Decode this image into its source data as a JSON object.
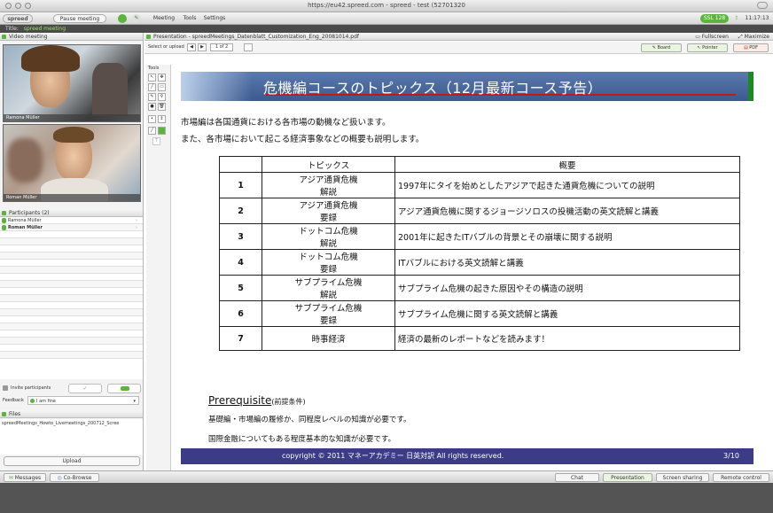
{
  "window": {
    "url": "https://eu42.spreed.com - spreed - test (52701320"
  },
  "appbar": {
    "logo": "spreed",
    "pause_label": "Pause meeting",
    "menu": [
      "Meeting",
      "Tools",
      "Settings"
    ],
    "status_badge": "SSL 128",
    "clock": "11:17:13"
  },
  "title_strip": {
    "label": "Title:",
    "value": "spreed meeting"
  },
  "left_panel": {
    "video_title": "Video meeting",
    "videos": [
      {
        "name": "Ramona Müller"
      },
      {
        "name": "Roman Müller"
      }
    ],
    "participants_title": "Participants (2)",
    "participants": [
      "Ramona Müller",
      "Roman Müller"
    ],
    "invite_label": "Invite participants",
    "feedback_label": "Feedback",
    "feedback_value": "I am fine",
    "files_title": "Files",
    "file_name": "spreedMeetings_Howto_Livemeetings_200712_Scree",
    "upload_label": "Upload"
  },
  "presentation": {
    "title": "Presentation - spreedMeetings_Datenblatt_Customization_Eng_20081014.pdf",
    "select_label": "Select or upload",
    "page": "1 of 2",
    "fullscreen_label": "Fullscreen",
    "maximize_label": "Maximize",
    "board_label": "Board",
    "pointer_label": "Pointer",
    "pdf_label": "PDF",
    "tools_label": "Tools"
  },
  "slide": {
    "title": "危機編コースのトピックス（12月最新コース予告）",
    "intro1": "市場編は各国通貨における各市場の動機など扱います。",
    "intro2": "また、各市場において起こる経済事象などの概要も説明します。",
    "table_headers": [
      "トピックス",
      "概要"
    ],
    "rows": [
      {
        "num": "1",
        "topic1": "アジア通貨危機",
        "topic2": "解説",
        "desc": "1997年にタイを始めとしたアジアで起きた通貨危機についての説明"
      },
      {
        "num": "2",
        "topic1": "アジア通貨危機",
        "topic2": "要録",
        "desc": "アジア通貨危機に関するジョージソロスの投機活動の英文読解と講義"
      },
      {
        "num": "3",
        "topic1": "ドットコム危機",
        "topic2": "解説",
        "desc": "2001年に起きたITバブルの背景とその崩壊に関する説明"
      },
      {
        "num": "4",
        "topic1": "ドットコム危機",
        "topic2": "要録",
        "desc": "ITバブルにおける英文読解と講義"
      },
      {
        "num": "5",
        "topic1": "サブプライム危機",
        "topic2": "解説",
        "desc": "サブプライム危機の起きた原因やその構造の説明"
      },
      {
        "num": "6",
        "topic1": "サブプライム危機",
        "topic2": "要録",
        "desc": "サブプライム危機に関する英文読解と講義"
      },
      {
        "num": "7",
        "topic1": "時事経済",
        "topic2": "",
        "desc": "経済の最新のレポートなどを読みます！"
      }
    ],
    "prereq_label": "Prerequisite",
    "prereq_paren": "(前提条件)",
    "prereq1": "基礎編・市場編の履修か、同程度レベルの知識が必要です。",
    "prereq2": "国際金融についてもある程度基本的な知識が必要です。",
    "copyright": "copyright © 2011 マネーアカデミー 日英対訳 All rights reserved.",
    "page_num": "3/10"
  },
  "bottombar": {
    "left_tabs": [
      "Messages",
      "Co-Browse"
    ],
    "right_tabs": [
      "Chat",
      "Presentation",
      "Screen sharing",
      "Remote control"
    ]
  },
  "colors": {
    "header_blue": "#3c5a8f",
    "footer_navy": "#3b3b86",
    "accent_green": "#5bb53c",
    "red_line": "#c81616"
  }
}
